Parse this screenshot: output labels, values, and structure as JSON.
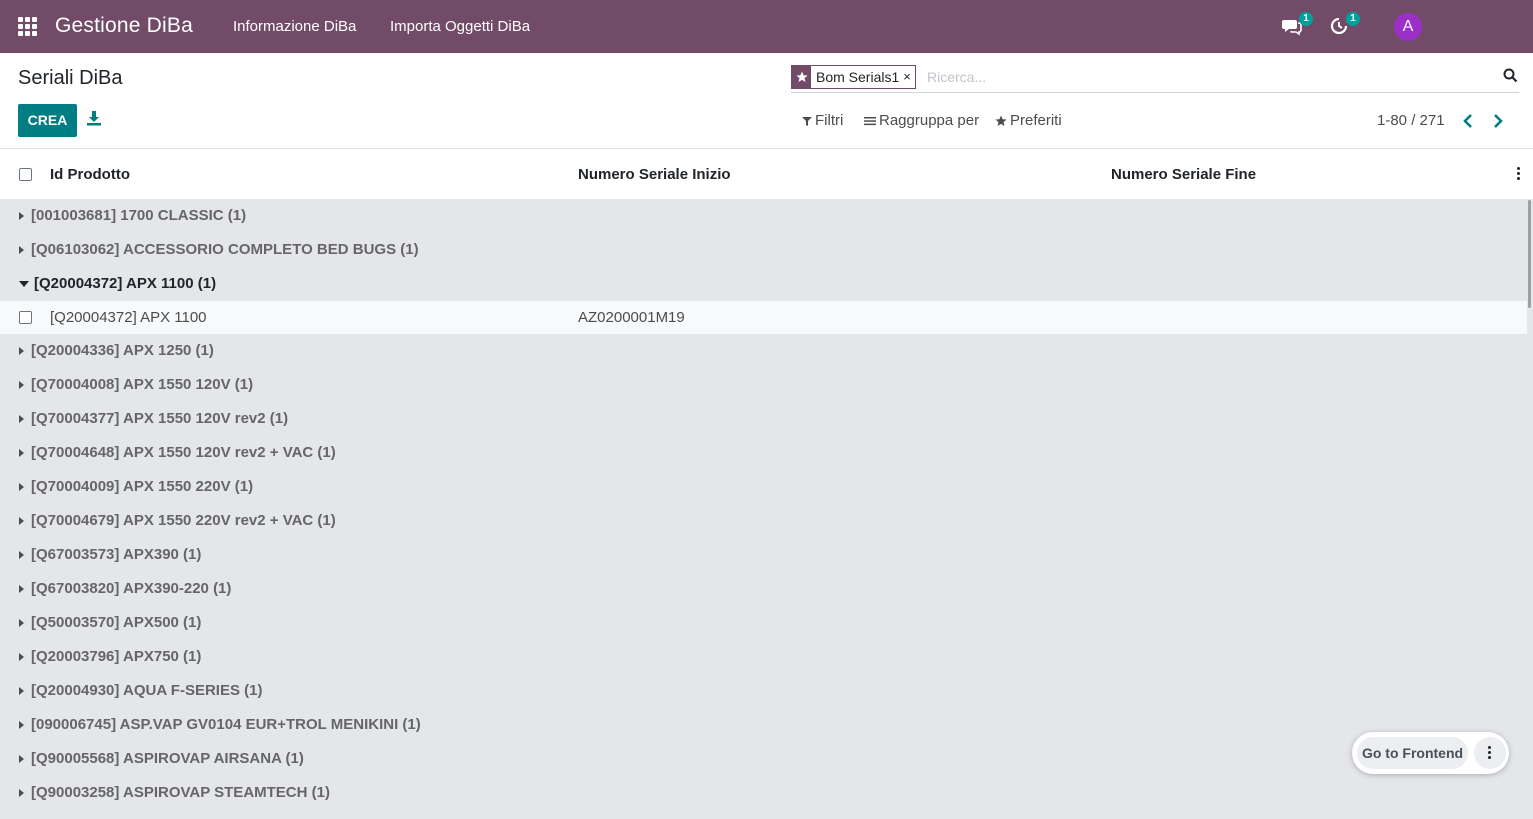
{
  "navbar": {
    "app_title": "Gestione DiBa",
    "menus": [
      "Informazione DiBa",
      "Importa Oggetti DiBa"
    ],
    "messages_count": "1",
    "activities_count": "1",
    "avatar_letter": "A"
  },
  "control_panel": {
    "breadcrumb": "Seriali DiBa",
    "create_label": "CREA",
    "facet_value": "Bom Serials1",
    "facet_remove": "×",
    "search_placeholder": "Ricerca...",
    "filters_label": "Filtri",
    "groupby_label": "Raggruppa per",
    "favorites_label": "Preferiti",
    "pager": "1-80 / 271"
  },
  "list": {
    "columns": [
      "Id Prodotto",
      "Numero Seriale Inizio",
      "Numero Seriale Fine"
    ],
    "groups": [
      {
        "label": "[001003681] 1700 CLASSIC (1)",
        "open": false
      },
      {
        "label": "[Q06103062] ACCESSORIO COMPLETO BED BUGS (1)",
        "open": false
      },
      {
        "label": "[Q20004372] APX 1100 (1)",
        "open": true,
        "records": [
          {
            "product": "[Q20004372] APX 1100",
            "serial_start": "AZ0200001M19",
            "serial_end": ""
          }
        ]
      },
      {
        "label": "[Q20004336] APX 1250 (1)",
        "open": false
      },
      {
        "label": "[Q70004008] APX 1550 120V (1)",
        "open": false
      },
      {
        "label": "[Q70004377] APX 1550 120V rev2 (1)",
        "open": false
      },
      {
        "label": "[Q70004648] APX 1550 120V rev2 + VAC (1)",
        "open": false
      },
      {
        "label": "[Q70004009] APX 1550 220V (1)",
        "open": false
      },
      {
        "label": "[Q70004679] APX 1550 220V rev2 + VAC (1)",
        "open": false
      },
      {
        "label": "[Q67003573] APX390 (1)",
        "open": false
      },
      {
        "label": "[Q67003820] APX390-220 (1)",
        "open": false
      },
      {
        "label": "[Q50003570] APX500 (1)",
        "open": false
      },
      {
        "label": "[Q20003796] APX750 (1)",
        "open": false
      },
      {
        "label": "[Q20004930] AQUA F-SERIES (1)",
        "open": false
      },
      {
        "label": "[090006745] ASP.VAP GV0104 EUR+TROL MENIKINI (1)",
        "open": false
      },
      {
        "label": "[Q90005568] ASPIROVAP AIRSANA (1)",
        "open": false
      },
      {
        "label": "[Q90003258] ASPIROVAP STEAMTECH (1)",
        "open": false
      }
    ]
  },
  "frontend_widget": {
    "label": "Go to Frontend"
  },
  "colors": {
    "brand": "#714b67",
    "primary_button": "#017e84",
    "badge": "#00a09d",
    "avatar": "#9b30c8"
  }
}
